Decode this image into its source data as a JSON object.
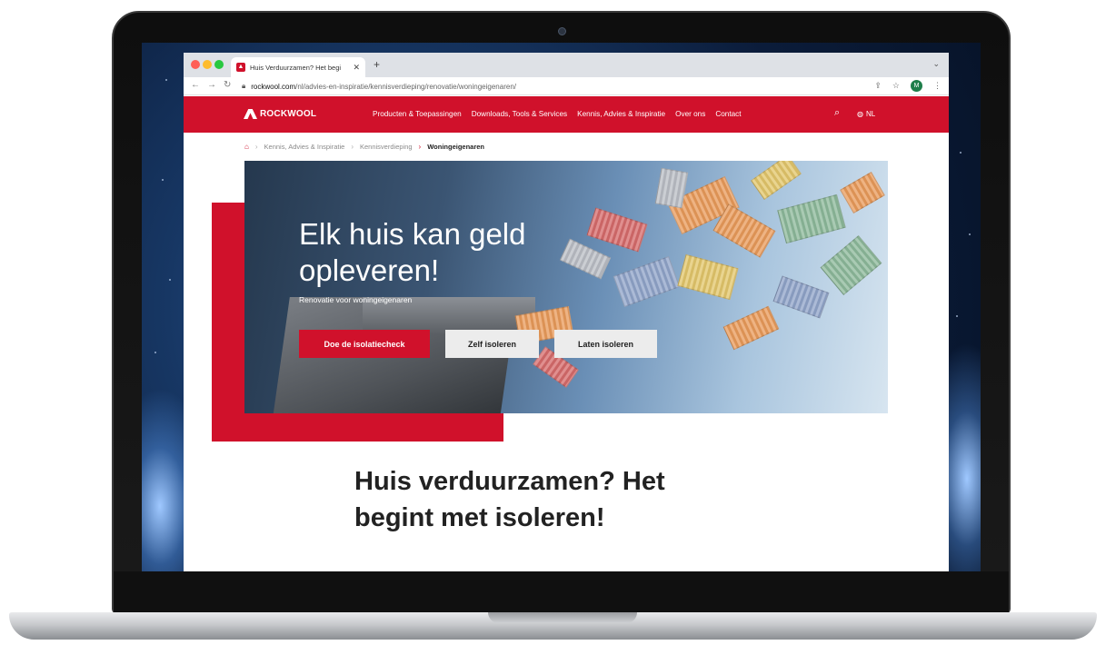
{
  "browser": {
    "tab_title": "Huis Verduurzamen? Het begi",
    "url_host": "rockwool.com",
    "url_path": "/nl/advies-en-inspiratie/kennisverdieping/renovatie/woningeigenaren/",
    "profile_initial": "M"
  },
  "header": {
    "brand": "ROCKWOOL",
    "nav": [
      "Producten & Toepassingen",
      "Downloads, Tools & Services",
      "Kennis, Advies & Inspiratie",
      "Over ons",
      "Contact"
    ],
    "language": "NL"
  },
  "breadcrumb": {
    "items": [
      "Kennis, Advies & Inspiratie",
      "Kennisverdieping"
    ],
    "current": "Woningeigenaren"
  },
  "hero": {
    "title_line1": "Elk huis kan geld",
    "title_line2": "opleveren!",
    "subtitle": "Renovatie voor woningeigenaren",
    "buttons": {
      "primary": "Doe de isolatiecheck",
      "secondary1": "Zelf isoleren",
      "secondary2": "Laten isoleren"
    }
  },
  "section": {
    "heading_line1": "Huis verduurzamen? Het",
    "heading_line2": "begint met isoleren!"
  },
  "colors": {
    "brand_red": "#d0112b",
    "button_grey": "#ececec"
  },
  "icons": [
    "home-icon",
    "search-icon",
    "globe-icon",
    "lock-icon",
    "star-icon",
    "share-icon",
    "back-icon",
    "forward-icon",
    "reload-icon"
  ]
}
